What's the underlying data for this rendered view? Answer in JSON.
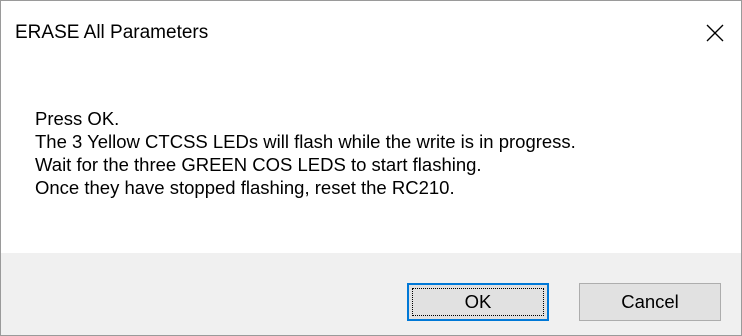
{
  "window": {
    "title": "ERASE All Parameters"
  },
  "icons": {
    "close": "close-icon"
  },
  "message": {
    "lines": [
      "Press OK.",
      "The 3 Yellow CTCSS LEDs will flash while the write is in progress.",
      "Wait for the three GREEN COS LEDS to start flashing.",
      "Once they have stopped flashing, reset the RC210."
    ]
  },
  "buttons": {
    "ok_label": "OK",
    "cancel_label": "Cancel"
  },
  "colors": {
    "footer_background": "#f0f0f0",
    "default_button_border": "#0078d7",
    "button_face": "#e1e1e1"
  }
}
